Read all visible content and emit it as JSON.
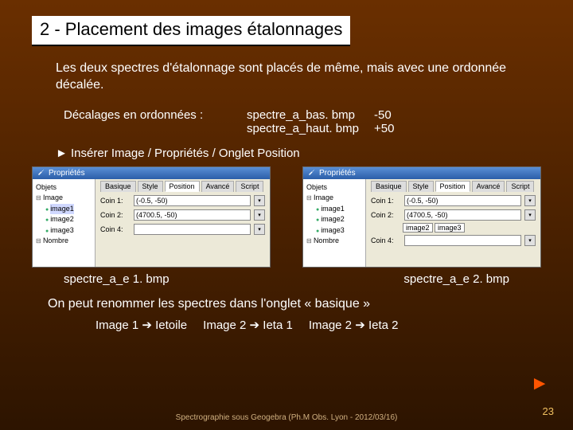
{
  "title": "2 - Placement des images étalonnages",
  "intro": "Les deux spectres d'étalonnage sont placés de même, mais avec une ordonnée décalée.",
  "decal_label": "Décalages en ordonnées :",
  "spec1": {
    "fn": "spectre_a_bas. bmp",
    "val": "-50"
  },
  "spec2": {
    "fn": "spectre_a_haut. bmp",
    "val": "+50"
  },
  "instruction": "► Insérer Image / Propriétés / Onglet Position",
  "panel": {
    "title": "Propriétés",
    "tree_root_label": "Objets",
    "tree_group_label": "Image",
    "tree_footer_label": "Nombre",
    "items": [
      "image1",
      "image2",
      "image3"
    ],
    "tabs": [
      "Basique",
      "Style",
      "Position",
      "Avancé",
      "Script"
    ],
    "fields": {
      "coin1": {
        "label": "Coin 1:",
        "value": "(-0.5, -50)"
      },
      "coin2": {
        "label": "Coin 2:",
        "value": "(4700.5, -50)"
      },
      "coin4": {
        "label": "Coin 4:",
        "value": ""
      }
    },
    "left_selected": "image1",
    "right_selected": [
      "image2",
      "image3"
    ]
  },
  "panel_labels": {
    "left": "spectre_a_e 1. bmp",
    "right": "spectre_a_e 2. bmp"
  },
  "rename_text": "On peut renommer les spectres dans l'onglet « basique »",
  "rename": {
    "a": "Image 1",
    "a2": "Ietoile",
    "b": "Image 2",
    "b2": "Ieta 1",
    "c": "Image 2",
    "c2": "Ieta 2"
  },
  "footer": "Spectrographie sous Geogebra (Ph.M Obs. Lyon - 2012/03/16)",
  "pagenum": "23",
  "advance": "►"
}
